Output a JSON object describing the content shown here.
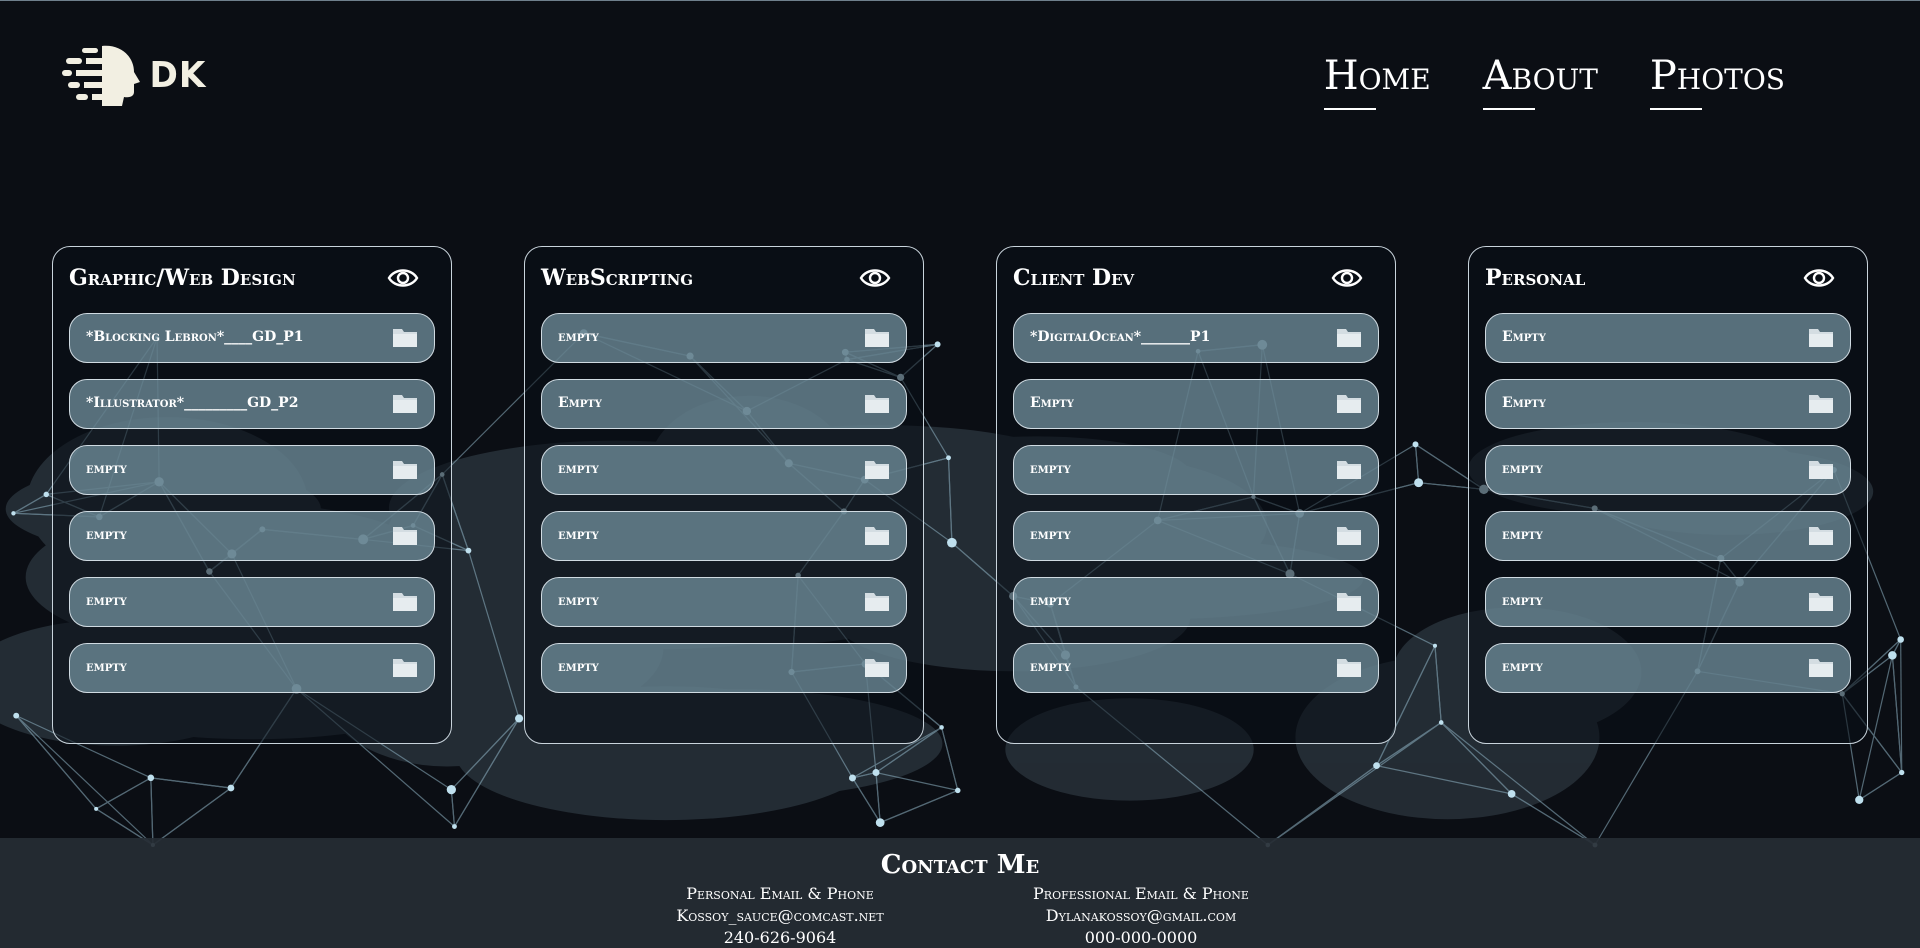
{
  "header": {
    "logo_text": "DK",
    "nav": [
      {
        "label": "Home"
      },
      {
        "label": "About"
      },
      {
        "label": "Photos"
      }
    ]
  },
  "cards": [
    {
      "title": "Graphic/Web Design",
      "slots": [
        {
          "label": "*Blocking Lebron*____GD_P1"
        },
        {
          "label": "*Illustrator*_________GD_P2"
        },
        {
          "label": "empty"
        },
        {
          "label": "empty"
        },
        {
          "label": "empty"
        },
        {
          "label": "empty"
        }
      ]
    },
    {
      "title": "WebScripting",
      "slots": [
        {
          "label": "empty"
        },
        {
          "label": "Empty"
        },
        {
          "label": "empty"
        },
        {
          "label": "empty"
        },
        {
          "label": "empty"
        },
        {
          "label": "empty"
        }
      ]
    },
    {
      "title": "Client Dev",
      "slots": [
        {
          "label": "*DigitalOcean*_______P1"
        },
        {
          "label": "Empty"
        },
        {
          "label": "empty"
        },
        {
          "label": "empty"
        },
        {
          "label": "empty"
        },
        {
          "label": "empty"
        }
      ]
    },
    {
      "title": "Personal",
      "slots": [
        {
          "label": "Empty"
        },
        {
          "label": "Empty"
        },
        {
          "label": "empty"
        },
        {
          "label": "empty"
        },
        {
          "label": "empty"
        },
        {
          "label": "empty"
        }
      ]
    }
  ],
  "footer": {
    "title": "Contact Me",
    "personal": {
      "heading": "Personal Email & Phone",
      "email": "Kossoy_sauce@comcast.net",
      "phone": "240-626-9064"
    },
    "professional": {
      "heading": "Professional Email & Phone",
      "email": "Dylanakossoy@gmail.com",
      "phone": "000-000-0000"
    }
  },
  "colors": {
    "background": "#0b0e14",
    "slot_fill": "#76969f",
    "network_lines": "#8fb3c4"
  }
}
